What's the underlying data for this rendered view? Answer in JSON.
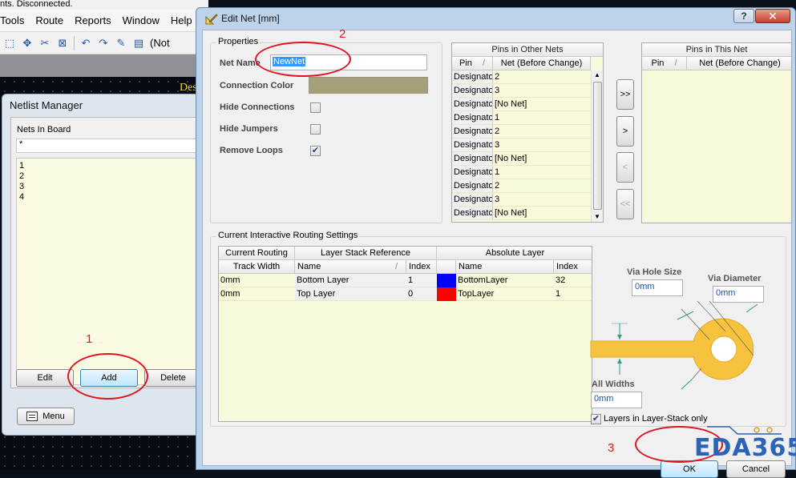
{
  "background_app": {
    "status_text": "nts. Disconnected.",
    "menus": [
      "Tools",
      "Route",
      "Reports",
      "Window",
      "Help"
    ],
    "toolbar_trailing_text": "(Not",
    "canvas_banner": "Des"
  },
  "netlist_manager": {
    "title": "Netlist Manager",
    "nets_label": "Nets In Board",
    "filter_value": "*",
    "nets": [
      "1",
      "2",
      "3",
      "4"
    ],
    "buttons": {
      "edit": "Edit",
      "add": "Add",
      "delete": "Delete",
      "menu": "Menu"
    }
  },
  "edit_net_dialog": {
    "title": "Edit Net [mm]",
    "help_glyph": "?",
    "close_glyph": "✕",
    "properties": {
      "group_title": "Properties",
      "net_name_label": "Net Name",
      "net_name_value": "NewNet",
      "connection_color_label": "Connection Color",
      "connection_color": "#a3a07a",
      "hide_connections_label": "Hide Connections",
      "hide_connections": false,
      "hide_jumpers_label": "Hide Jumpers",
      "hide_jumpers": false,
      "remove_loops_label": "Remove Loops",
      "remove_loops": true
    },
    "pins_other_nets": {
      "title": "Pins in Other Nets",
      "col_pin": "Pin",
      "col_net": "Net (Before Change)",
      "rows": [
        {
          "pin": "Designato",
          "net": "2"
        },
        {
          "pin": "Designato",
          "net": "3"
        },
        {
          "pin": "Designato",
          "net": "[No Net]"
        },
        {
          "pin": "Designato",
          "net": "1"
        },
        {
          "pin": "Designato",
          "net": "2"
        },
        {
          "pin": "Designato",
          "net": "3"
        },
        {
          "pin": "Designato",
          "net": "[No Net]"
        },
        {
          "pin": "Designato",
          "net": "1"
        },
        {
          "pin": "Designato",
          "net": "2"
        },
        {
          "pin": "Designato",
          "net": "3"
        },
        {
          "pin": "Designato",
          "net": "[No Net]"
        }
      ]
    },
    "pins_this_net": {
      "title": "Pins in This Net",
      "col_pin": "Pin",
      "col_net": "Net (Before Change)",
      "rows": []
    },
    "move_buttons": [
      ">>",
      ">",
      "<",
      "<<"
    ],
    "routing": {
      "group_title": "Current Interactive Routing Settings",
      "head_current_routing": "Current Routing",
      "head_layer_stack": "Layer Stack Reference",
      "head_absolute": "Absolute Layer",
      "col_track_width": "Track Width",
      "col_name": "Name",
      "col_index": "Index",
      "col_abs_name": "Name",
      "col_abs_index": "Index",
      "rows": [
        {
          "width": "0mm",
          "name": "Bottom Layer",
          "index": "1",
          "color": "#0000ff",
          "abs_name": "BottomLayer",
          "abs_index": "32"
        },
        {
          "width": "0mm",
          "name": "Top Layer",
          "index": "0",
          "color": "#ff0000",
          "abs_name": "TopLayer",
          "abs_index": "1"
        }
      ],
      "via_hole_size_label": "Via Hole Size",
      "via_hole_size": "0mm",
      "via_diameter_label": "Via Diameter",
      "via_diameter": "0mm",
      "all_widths_label": "All Widths",
      "all_widths": "0mm",
      "layers_in_stack_label": "Layers in Layer-Stack only",
      "layers_in_stack": true
    },
    "ok": "OK",
    "cancel": "Cancel"
  },
  "annotations": [
    "1",
    "2",
    "3"
  ],
  "watermark": "EDA365"
}
